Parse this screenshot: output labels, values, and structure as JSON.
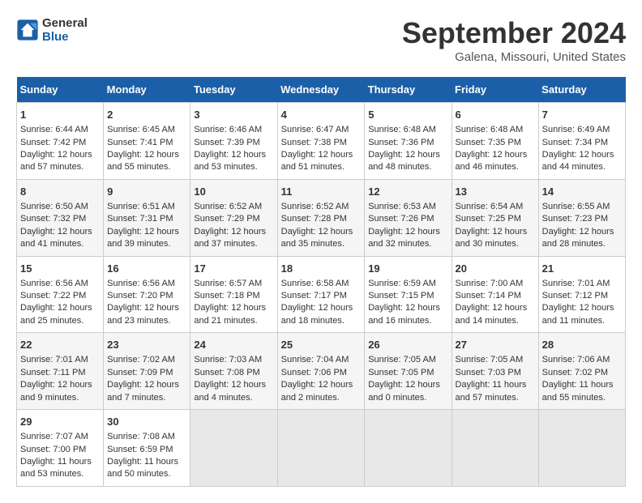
{
  "header": {
    "logo_line1": "General",
    "logo_line2": "Blue",
    "month": "September 2024",
    "location": "Galena, Missouri, United States"
  },
  "days_of_week": [
    "Sunday",
    "Monday",
    "Tuesday",
    "Wednesday",
    "Thursday",
    "Friday",
    "Saturday"
  ],
  "weeks": [
    [
      {
        "day": "1",
        "info": "Sunrise: 6:44 AM\nSunset: 7:42 PM\nDaylight: 12 hours and 57 minutes."
      },
      {
        "day": "2",
        "info": "Sunrise: 6:45 AM\nSunset: 7:41 PM\nDaylight: 12 hours and 55 minutes."
      },
      {
        "day": "3",
        "info": "Sunrise: 6:46 AM\nSunset: 7:39 PM\nDaylight: 12 hours and 53 minutes."
      },
      {
        "day": "4",
        "info": "Sunrise: 6:47 AM\nSunset: 7:38 PM\nDaylight: 12 hours and 51 minutes."
      },
      {
        "day": "5",
        "info": "Sunrise: 6:48 AM\nSunset: 7:36 PM\nDaylight: 12 hours and 48 minutes."
      },
      {
        "day": "6",
        "info": "Sunrise: 6:48 AM\nSunset: 7:35 PM\nDaylight: 12 hours and 46 minutes."
      },
      {
        "day": "7",
        "info": "Sunrise: 6:49 AM\nSunset: 7:34 PM\nDaylight: 12 hours and 44 minutes."
      }
    ],
    [
      {
        "day": "8",
        "info": "Sunrise: 6:50 AM\nSunset: 7:32 PM\nDaylight: 12 hours and 41 minutes."
      },
      {
        "day": "9",
        "info": "Sunrise: 6:51 AM\nSunset: 7:31 PM\nDaylight: 12 hours and 39 minutes."
      },
      {
        "day": "10",
        "info": "Sunrise: 6:52 AM\nSunset: 7:29 PM\nDaylight: 12 hours and 37 minutes."
      },
      {
        "day": "11",
        "info": "Sunrise: 6:52 AM\nSunset: 7:28 PM\nDaylight: 12 hours and 35 minutes."
      },
      {
        "day": "12",
        "info": "Sunrise: 6:53 AM\nSunset: 7:26 PM\nDaylight: 12 hours and 32 minutes."
      },
      {
        "day": "13",
        "info": "Sunrise: 6:54 AM\nSunset: 7:25 PM\nDaylight: 12 hours and 30 minutes."
      },
      {
        "day": "14",
        "info": "Sunrise: 6:55 AM\nSunset: 7:23 PM\nDaylight: 12 hours and 28 minutes."
      }
    ],
    [
      {
        "day": "15",
        "info": "Sunrise: 6:56 AM\nSunset: 7:22 PM\nDaylight: 12 hours and 25 minutes."
      },
      {
        "day": "16",
        "info": "Sunrise: 6:56 AM\nSunset: 7:20 PM\nDaylight: 12 hours and 23 minutes."
      },
      {
        "day": "17",
        "info": "Sunrise: 6:57 AM\nSunset: 7:18 PM\nDaylight: 12 hours and 21 minutes."
      },
      {
        "day": "18",
        "info": "Sunrise: 6:58 AM\nSunset: 7:17 PM\nDaylight: 12 hours and 18 minutes."
      },
      {
        "day": "19",
        "info": "Sunrise: 6:59 AM\nSunset: 7:15 PM\nDaylight: 12 hours and 16 minutes."
      },
      {
        "day": "20",
        "info": "Sunrise: 7:00 AM\nSunset: 7:14 PM\nDaylight: 12 hours and 14 minutes."
      },
      {
        "day": "21",
        "info": "Sunrise: 7:01 AM\nSunset: 7:12 PM\nDaylight: 12 hours and 11 minutes."
      }
    ],
    [
      {
        "day": "22",
        "info": "Sunrise: 7:01 AM\nSunset: 7:11 PM\nDaylight: 12 hours and 9 minutes."
      },
      {
        "day": "23",
        "info": "Sunrise: 7:02 AM\nSunset: 7:09 PM\nDaylight: 12 hours and 7 minutes."
      },
      {
        "day": "24",
        "info": "Sunrise: 7:03 AM\nSunset: 7:08 PM\nDaylight: 12 hours and 4 minutes."
      },
      {
        "day": "25",
        "info": "Sunrise: 7:04 AM\nSunset: 7:06 PM\nDaylight: 12 hours and 2 minutes."
      },
      {
        "day": "26",
        "info": "Sunrise: 7:05 AM\nSunset: 7:05 PM\nDaylight: 12 hours and 0 minutes."
      },
      {
        "day": "27",
        "info": "Sunrise: 7:05 AM\nSunset: 7:03 PM\nDaylight: 11 hours and 57 minutes."
      },
      {
        "day": "28",
        "info": "Sunrise: 7:06 AM\nSunset: 7:02 PM\nDaylight: 11 hours and 55 minutes."
      }
    ],
    [
      {
        "day": "29",
        "info": "Sunrise: 7:07 AM\nSunset: 7:00 PM\nDaylight: 11 hours and 53 minutes."
      },
      {
        "day": "30",
        "info": "Sunrise: 7:08 AM\nSunset: 6:59 PM\nDaylight: 11 hours and 50 minutes."
      },
      {
        "day": "",
        "info": ""
      },
      {
        "day": "",
        "info": ""
      },
      {
        "day": "",
        "info": ""
      },
      {
        "day": "",
        "info": ""
      },
      {
        "day": "",
        "info": ""
      }
    ]
  ]
}
